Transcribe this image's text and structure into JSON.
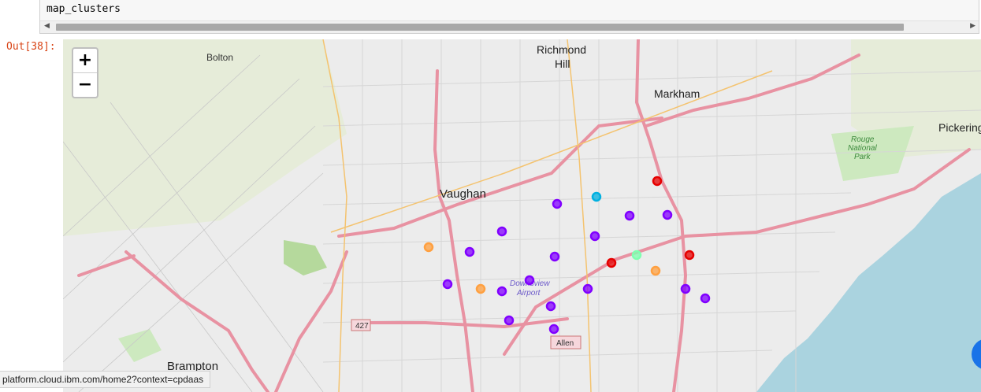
{
  "cell": {
    "code": "map_clusters",
    "output_prompt": "Out[38]:"
  },
  "map_controls": {
    "zoom_in": "+",
    "zoom_out": "−"
  },
  "places": [
    {
      "name": "Bolton"
    },
    {
      "name": "Richmond"
    },
    {
      "name": "Hill"
    },
    {
      "name": "Markham"
    },
    {
      "name": "Vaughan"
    },
    {
      "name": "Pickering"
    },
    {
      "name": "Brampton"
    },
    {
      "name": "Rouge"
    },
    {
      "name": "National"
    },
    {
      "name": "Park"
    },
    {
      "name": "Downsview"
    },
    {
      "name": "Airport"
    }
  ],
  "road_labels": [
    "427",
    "Allen"
  ],
  "cluster_colors": {
    "red": "#e60000",
    "purple": "#8000ff",
    "orange": "#ffa040",
    "blue": "#00b0e0",
    "mint": "#80ffb0"
  },
  "status_url": "platform.cloud.ibm.com/home2?context=cpdaas"
}
